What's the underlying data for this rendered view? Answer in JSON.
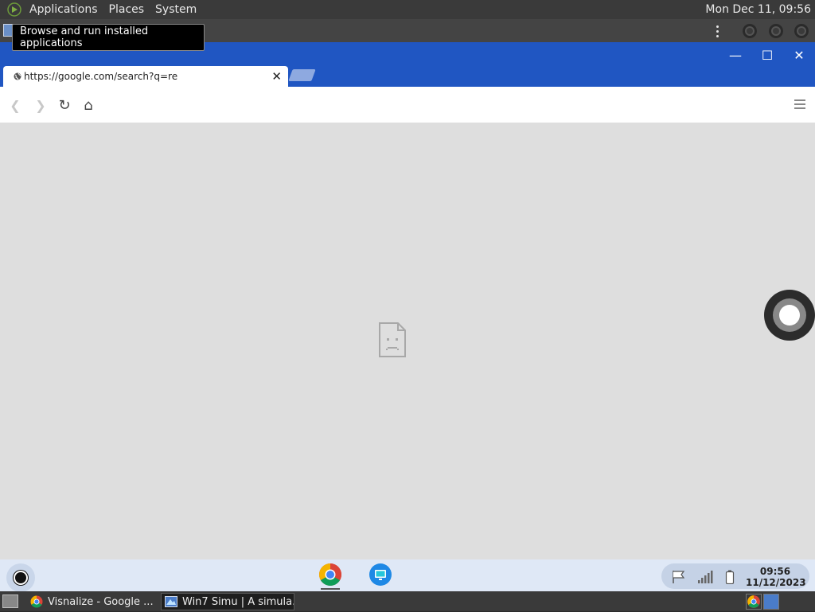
{
  "top_panel": {
    "menus": [
      "Applications",
      "Places",
      "System"
    ],
    "clock": "Mon Dec 11, 09:56"
  },
  "tooltip": {
    "text": "Browse and run installed applications"
  },
  "browser": {
    "tab_title": "https://google.com/search?q=re",
    "tab_close": "✕",
    "window_controls": {
      "minimize": "—",
      "maximize": "☐",
      "close": "✕"
    },
    "toolbar": {
      "back": "❮",
      "forward": "❯",
      "reload": "↻",
      "home": "⌂"
    }
  },
  "shelf": {
    "clock_time": "09:56",
    "clock_date": "11/12/2023",
    "pinned_apps": [
      "chrome-icon",
      "remote-desktop-icon"
    ],
    "tray_icons": [
      "flag-icon",
      "signal-icon",
      "battery-icon"
    ]
  },
  "host_taskbar": {
    "tasks": [
      {
        "label": "Visnalize - Google ...",
        "icon": "chrome-icon",
        "active": false
      },
      {
        "label": "Win7 Simu | A simula...",
        "icon": "win7-simu-icon",
        "active": true
      }
    ]
  },
  "colors": {
    "browser_accent": "#2056c2",
    "content_bg": "#dedede",
    "panel_bg": "#3a3a3a",
    "shelf_bg": "#dfe8f6"
  }
}
